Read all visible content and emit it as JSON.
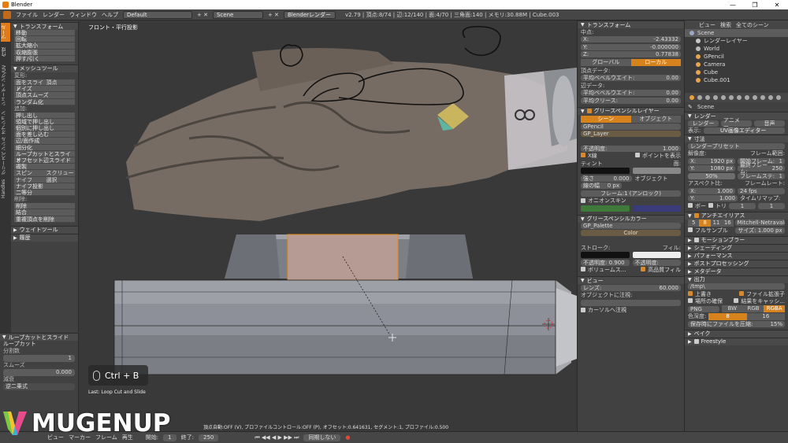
{
  "window": {
    "title": "Blender",
    "controls": [
      "—",
      "❐",
      "✕"
    ]
  },
  "info_header": {
    "menus": [
      "ファイル",
      "レンダー",
      "ウィンドウ",
      "ヘルプ"
    ],
    "screen_layout": "Default",
    "scene": "Scene",
    "engine": "Blenderレンダー",
    "stats": "v2.79 | 頂点:8/74 | 辺:12/140 | 面:4/70 | 三角面:140 | メモリ:30.88M | Cube.003"
  },
  "tool_tabs": [
    "ツール",
    "作成",
    "シェーディング/UV",
    "オプション",
    "グリースペンシル",
    "Handles"
  ],
  "tool_shelf": {
    "transform_header": "トランスフォーム",
    "transform_buttons": [
      "移動",
      "回転",
      "拡大縮小",
      "収縮膨張",
      "押す/引く"
    ],
    "mesh_tools_header": "メッシュツール",
    "deform_label": "変形:",
    "deform_buttons": [
      [
        "面をスライド",
        "頂点"
      ],
      [
        "ノイズ"
      ],
      [
        "頂点スムーズ"
      ],
      [
        "ランダム化"
      ]
    ],
    "add_label": "追加:",
    "add_buttons": [
      [
        "押し出し"
      ],
      [
        "領域で押し出し"
      ],
      [
        "個別に押し出し"
      ],
      [
        "面を差し込む"
      ],
      [
        "辺/面作成"
      ],
      [
        "細分化"
      ],
      [
        "ループカットとスライド"
      ],
      [
        "オフセット辺スライド"
      ],
      [
        "複製"
      ],
      [
        "スピン",
        "スクリュー"
      ],
      [
        "ナイフ",
        "選択"
      ],
      [
        "ナイフ投影"
      ],
      [
        "二等分"
      ]
    ],
    "remove_label": "削除:",
    "remove_buttons": [
      "削除",
      "結合",
      "重複頂点を削除"
    ],
    "weight_tools_header": "ウェイトツール",
    "history_header": "履歴"
  },
  "operator_panel": {
    "header": "ループカットとスライド",
    "title": "ループカット",
    "cuts_label": "分割数",
    "cuts_value": "1",
    "smooth_label": "スムーズ",
    "smooth_value": "0.000",
    "falloff_label": "減衰",
    "falloff_value": "逆二乗式"
  },
  "viewport": {
    "title": "フロント・平行投影",
    "shortcut": "Ctrl + B",
    "last_op": "Last: Loop Cut and Slide"
  },
  "properties_n": {
    "transform_header": "トランスフォーム",
    "median_label": "中点:",
    "x_label": "X:",
    "x_value": "-2.43332",
    "y_label": "Y:",
    "y_value": "-0.000000",
    "z_label": "Z:",
    "z_value": "0.77838",
    "space_global": "グローバル",
    "space_local": "ローカル",
    "vertex_data_label": "頂点データ:",
    "bevel_weight_label": "平均ベベルウエイト:",
    "bevel_weight_value": "0.00",
    "edge_data_label": "辺データ:",
    "edge_bevel_label": "平均ベベルウエイト:",
    "edge_bevel_value": "0.00",
    "crease_label": "平均クリース:",
    "crease_value": "0.00",
    "gp_layer_header": "グリースペンシルレイヤー",
    "gp_tab_scene": "シーン",
    "gp_tab_object": "オブジェクト",
    "gpencil_name": "GPencil",
    "gp_layer_name": "GP_Layer",
    "opacity_label": "不透明度:",
    "opacity_value": "1.000",
    "xray_label": "X線",
    "show_points_label": "ポイントを表示",
    "tint_label": "ティント",
    "frame_label": "面:",
    "strength_label": "強さ",
    "strength_value": "0.000",
    "object_label": "オブジェクト",
    "thickness_label": "線の幅",
    "thickness_value": "0 px",
    "frame_unlock": "フレーム:1 (アンロック)",
    "onion_label": "オニオンスキン",
    "gp_color_header": "グリースペンシルカラー",
    "palette_name": "GP_Palette",
    "color_name": "Color",
    "stroke_label": "ストローク:",
    "fill_label": "フィル:",
    "stroke_opacity_label": "不透明度: 0.900",
    "fill_opacity_label": "不透明度:",
    "volumetric_label": "ボリュームス...",
    "hq_fill_label": "高品質フィル",
    "view_header": "ビュー",
    "lens_label": "レンズ:",
    "lens_value": "60.000",
    "lock_object_label": "オブジェクトに注視:",
    "lock_cursor_label": "カーソルへ注視"
  },
  "outliner": {
    "tabs": [
      "ビュー",
      "検索",
      "全てのシーン"
    ],
    "items": [
      {
        "name": "Scene",
        "color": "#9aa8c8"
      },
      {
        "name": "レンダーレイヤー",
        "color": "#c7c7c7"
      },
      {
        "name": "World",
        "color": "#bbbbbb"
      },
      {
        "name": "GPencil",
        "color": "#e6a64f"
      },
      {
        "name": "Camera",
        "color": "#e6a64f"
      },
      {
        "name": "Cube",
        "color": "#e6a64f"
      },
      {
        "name": "Cube.001",
        "color": "#e6a64f"
      }
    ]
  },
  "render_props": {
    "scene_label": "Scene",
    "render_header": "レンダー",
    "render_buttons": [
      "レンダー",
      "アニメー...",
      "音声"
    ],
    "display_label": "表示:",
    "display_value": "UV画像エディター",
    "dimensions_header": "寸法",
    "preset_label": "レンダープリセット",
    "resolution_label": "解像度:",
    "res_x_label": "X:",
    "res_x_value": "1920 px",
    "res_y_label": "Y:",
    "res_y_value": "1080 px",
    "res_pct": "50%",
    "frame_range_label": "フレーム範囲:",
    "start_frame_label": "開始フレーム:",
    "start_frame_value": "1",
    "end_frame_label": "最終フレーム:",
    "end_frame_value": "250",
    "frame_step_label": "フレームステ:",
    "frame_step_value": "1",
    "aspect_label": "アスペクト比:",
    "asp_x_label": "X:",
    "asp_x_value": "1.000",
    "asp_y_label": "Y:",
    "asp_y_value": "1.000",
    "border_label": "ボー",
    "crop_label": "トリ",
    "frame_rate_label": "フレームレート:",
    "fps_value": "24 fps",
    "time_remap_label": "タイムリマップ:",
    "remap_old": "1",
    "remap_new": "1",
    "aa_header": "アンチエイリアス",
    "aa_samples": [
      "5",
      "8",
      "11",
      "16"
    ],
    "aa_filter": "Mitchell-Netravali",
    "full_sample_label": "フルサンプル",
    "aa_size": "サイズ: 1.000 px",
    "sections": [
      "モーションブラー",
      "シェーディング",
      "パフォーマンス",
      "ポストプロセッシング",
      "メタデータ",
      "出力"
    ],
    "output_path": "/tmp\\",
    "overwrite_label": "上書き",
    "ext_label": "ファイル拡張子",
    "placeholders_label": "場所の確保",
    "cache_label": "結果をキャッシ...",
    "format_value": "PNG",
    "color_modes": [
      "BW",
      "RGB",
      "RGBA"
    ],
    "color_depth_label": "色深度:",
    "depth_8": "8",
    "depth_16": "16",
    "compression_label": "保存時にファイルを圧縮:",
    "compression_value": "15%",
    "bake_header": "ベイク",
    "freestyle_header": "Freestyle"
  },
  "timeline": {
    "menus": [
      "ビュー",
      "マーカー",
      "フレーム",
      "再生"
    ],
    "start_label": "開始:",
    "start_value": "1",
    "end_label": "終了:",
    "end_value": "250",
    "sync_value": "同期しない"
  },
  "status_text": "頂点自動:OFF (V), プロファイルコントロール:OFF (P), オフセット:0.641631, セグメント:1, プロファイル:0.500",
  "logo_text": "MUGENUP"
}
